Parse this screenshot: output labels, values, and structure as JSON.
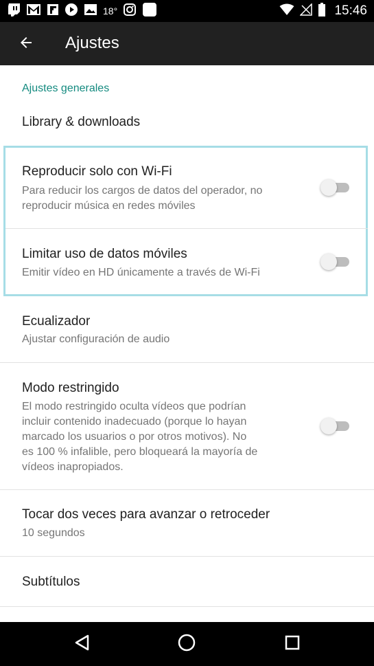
{
  "status_bar": {
    "temperature": "18°",
    "time": "15:46",
    "left_icons": [
      "twitch-icon",
      "gmail-icon",
      "flipboard-icon",
      "youtube-icon",
      "gallery-icon",
      "instagram-icon",
      "notification-icon"
    ],
    "right_icons": [
      "wifi-icon",
      "signal-icon",
      "battery-icon"
    ]
  },
  "app_bar": {
    "title": "Ajustes",
    "back_icon": "arrow-back-icon"
  },
  "section_header": "Ajustes generales",
  "settings": [
    {
      "title": "Library & downloads"
    },
    {
      "title": "Reproducir solo con Wi-Fi",
      "subtitle_lines": [
        "Para reducir los cargos de datos del operador, no",
        "reproducir música en redes móviles"
      ],
      "toggle": false
    },
    {
      "title": "Limitar uso de datos móviles",
      "subtitle_lines": [
        "Emitir vídeo en HD únicamente a través de Wi-Fi"
      ],
      "toggle": false
    },
    {
      "title": "Ecualizador",
      "subtitle_lines": [
        "Ajustar configuración de audio"
      ]
    },
    {
      "title": "Modo restringido",
      "subtitle_lines": [
        "El modo restringido oculta vídeos que podrían",
        "incluir contenido inadecuado (porque lo hayan",
        "marcado los usuarios o por otros motivos). No",
        "es 100 % infalible, pero bloqueará la mayoría de",
        "vídeos inapropiados."
      ],
      "toggle": false
    },
    {
      "title": "Tocar dos veces para avanzar o retroceder",
      "subtitle_lines": [
        "10 segundos"
      ]
    },
    {
      "title": "Subtítulos"
    }
  ],
  "nav_bar": {
    "icons": [
      "back-triangle-icon",
      "home-circle-icon",
      "recents-square-icon"
    ]
  },
  "colors": {
    "accent": "#138a7f",
    "appbar": "#212121",
    "highlight": "#a6dde6"
  }
}
